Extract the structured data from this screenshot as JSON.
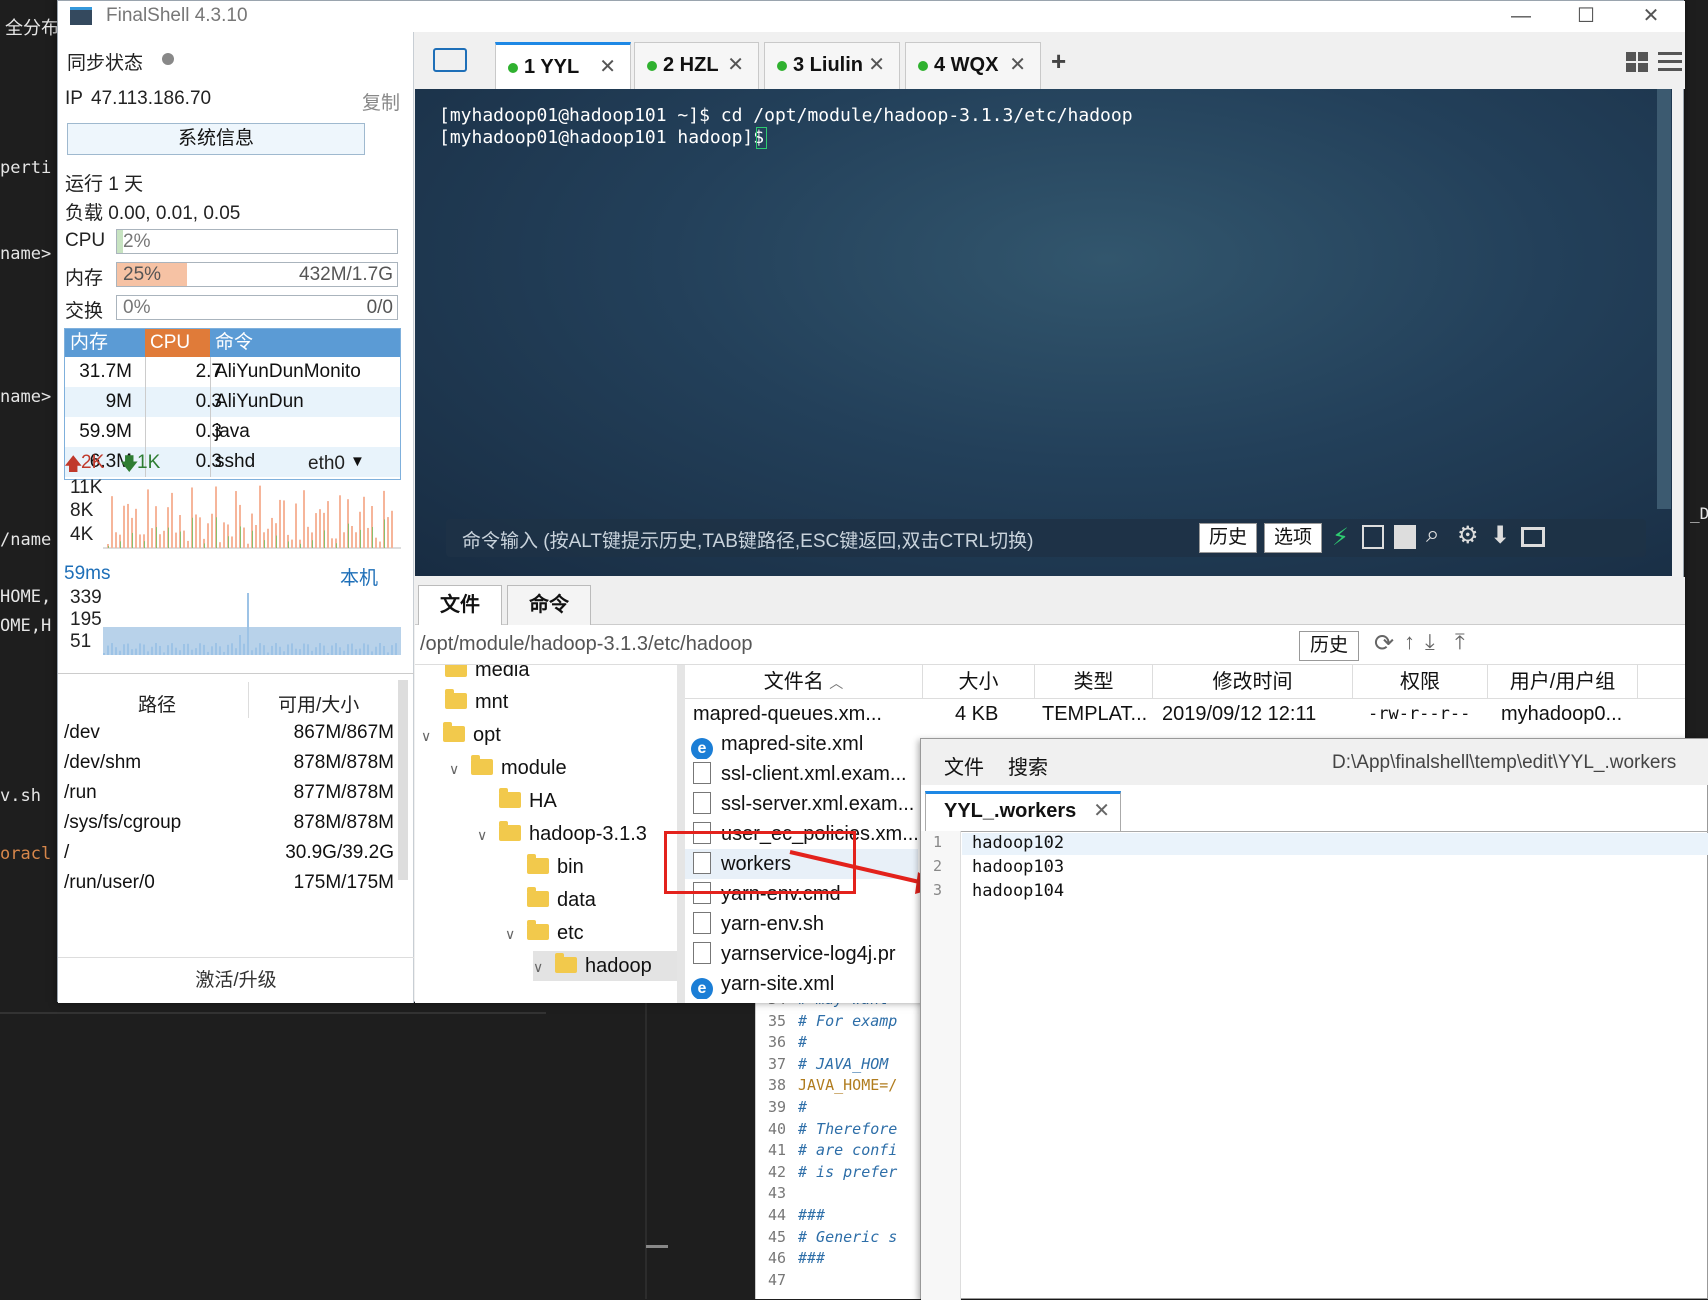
{
  "background": {
    "left_fragments": [
      "全分布",
      "perti",
      "name>",
      "name>",
      "/name",
      "HOME,",
      "OME,H",
      "v.sh",
      "oracl"
    ],
    "editor_lines": [
      {
        "num": "34",
        "text": "# may want"
      },
      {
        "num": "35",
        "text": "# For examp"
      },
      {
        "num": "36",
        "text": "#"
      },
      {
        "num": "37",
        "text": "#  JAVA_HOM"
      },
      {
        "num": "38",
        "text": "JAVA_HOME=/"
      },
      {
        "num": "39",
        "text": "#"
      },
      {
        "num": "40",
        "text": "# Therefore"
      },
      {
        "num": "41",
        "text": "# are confi"
      },
      {
        "num": "42",
        "text": "# is prefer"
      },
      {
        "num": "43",
        "text": ""
      },
      {
        "num": "44",
        "text": "###"
      },
      {
        "num": "45",
        "text": "# Generic s"
      },
      {
        "num": "46",
        "text": "###"
      },
      {
        "num": "47",
        "text": ""
      }
    ],
    "right_edge": "_D"
  },
  "window": {
    "title": "FinalShell 4.3.10"
  },
  "sidebar": {
    "sync_label": "同步状态",
    "ip_label": "IP",
    "ip": "47.113.186.70",
    "copy": "复制",
    "sysinfo_button": "系统信息",
    "uptime": "运行 1 天",
    "load": "负载 0.00, 0.01, 0.05",
    "cpu_label": "CPU",
    "cpu_value": "2%",
    "cpu_fraction": 0.02,
    "mem_label": "内存",
    "mem_value": "25%",
    "mem_size": "432M/1.7G",
    "mem_fraction": 0.25,
    "swap_label": "交换",
    "swap_value": "0%",
    "swap_size": "0/0",
    "swap_fraction": 0,
    "proc_headers": [
      "内存",
      "CPU",
      "命令"
    ],
    "processes": [
      {
        "mem": "31.7M",
        "cpu": "2.7",
        "cmd": "AliYunDunMonito"
      },
      {
        "mem": "9M",
        "cpu": "0.3",
        "cmd": "AliYunDun"
      },
      {
        "mem": "59.9M",
        "cpu": "0.3",
        "cmd": "java"
      },
      {
        "mem": "6.3M",
        "cpu": "0.3",
        "cmd": "sshd"
      }
    ],
    "net": {
      "up": "2K",
      "down": "1K",
      "iface": "eth0",
      "ticks": [
        "11K",
        "8K",
        "4K"
      ]
    },
    "ping": {
      "latency": "59ms",
      "target": "本机",
      "ticks": [
        "339",
        "195",
        "51"
      ]
    },
    "disk_headers": [
      "路径",
      "可用/大小"
    ],
    "disks": [
      {
        "path": "/dev",
        "size": "867M/867M"
      },
      {
        "path": "/dev/shm",
        "size": "878M/878M"
      },
      {
        "path": "/run",
        "size": "877M/878M"
      },
      {
        "path": "/sys/fs/cgroup",
        "size": "878M/878M"
      },
      {
        "path": "/",
        "size": "30.9G/39.2G"
      },
      {
        "path": "/run/user/0",
        "size": "175M/175M"
      }
    ],
    "activate": "激活/升级"
  },
  "tabs": [
    {
      "label": "1 YYL"
    },
    {
      "label": "2 HZL"
    },
    {
      "label": "3 Liulin"
    },
    {
      "label": "4 WQX"
    }
  ],
  "terminal": {
    "lines": [
      "[myhadoop01@hadoop101 ~]$ cd /opt/module/hadoop-3.1.3/etc/hadoop",
      "[myhadoop01@hadoop101 hadoop]$ "
    ],
    "command_placeholder": "命令输入 (按ALT键提示历史,TAB键路径,ESC键返回,双击CTRL切换)",
    "history_button": "历史",
    "options_button": "选项"
  },
  "files": {
    "tab_files": "文件",
    "tab_commands": "命令",
    "path": "/opt/module/hadoop-3.1.3/etc/hadoop",
    "history_button": "历史",
    "tree": [
      {
        "label": "media"
      },
      {
        "label": "mnt"
      },
      {
        "label": "opt"
      },
      {
        "label": "module"
      },
      {
        "label": "HA"
      },
      {
        "label": "hadoop-3.1.3"
      },
      {
        "label": "bin"
      },
      {
        "label": "data"
      },
      {
        "label": "etc"
      },
      {
        "label": "hadoop"
      }
    ],
    "columns": [
      "文件名",
      "大小",
      "类型",
      "修改时间",
      "权限",
      "用户/用户组"
    ],
    "first_row": {
      "name": "mapred-queues.xm...",
      "size": "4 KB",
      "type": "TEMPLAT...",
      "mtime": "2019/09/12 12:11",
      "perm": "-rw-r--r--",
      "owner": "myhadoop0..."
    },
    "list": [
      {
        "name": "mapred-site.xml",
        "icon": "ie-icon"
      },
      {
        "name": "ssl-client.xml.exam...",
        "icon": "file-icon"
      },
      {
        "name": "ssl-server.xml.exam...",
        "icon": "file-icon"
      },
      {
        "name": "user_ec_policies.xm...",
        "icon": "file-icon"
      },
      {
        "name": "workers",
        "icon": "file-icon"
      },
      {
        "name": "yarn-env.cmd",
        "icon": "file-icon"
      },
      {
        "name": "yarn-env.sh",
        "icon": "file-icon"
      },
      {
        "name": "yarnservice-log4j.pr",
        "icon": "file-icon"
      },
      {
        "name": "yarn-site.xml",
        "icon": "ie-icon"
      }
    ]
  },
  "editor": {
    "menu_file": "文件",
    "menu_search": "搜索",
    "path": "D:\\App\\finalshell\\temp\\edit\\YYL_.workers",
    "tab": "YYL_.workers",
    "lines": [
      {
        "num": "1",
        "text": "hadoop102"
      },
      {
        "num": "2",
        "text": "hadoop103"
      },
      {
        "num": "3",
        "text": "hadoop104"
      }
    ]
  },
  "colors": {
    "accent": "#1e88e5",
    "highlight_box": "#e3221c",
    "tab_dot": "#2fb12f",
    "proc_header": "#5b9bd5",
    "proc_cpu_header": "#e07b39"
  }
}
